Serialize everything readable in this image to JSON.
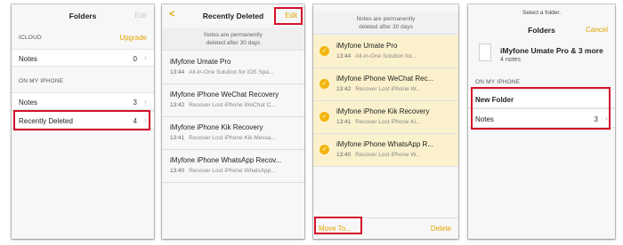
{
  "panel1": {
    "title": "Folders",
    "edit": "Edit",
    "icloud_label": "ICLOUD",
    "upgrade": "Upgrade",
    "icloud_notes": {
      "label": "Notes",
      "count": "0"
    },
    "iphone_label": "ON MY IPHONE",
    "iphone_notes": {
      "label": "Notes",
      "count": "3"
    },
    "recently_deleted": {
      "label": "Recently Deleted",
      "count": "4"
    }
  },
  "panel2": {
    "back": "<",
    "title": "Recently Deleted",
    "edit": "Edit",
    "banner_line1": "Notes are permanently",
    "banner_line2": "deleted after 30 days",
    "notes": [
      {
        "title": "iMyfone Umate Pro",
        "time": "13:44",
        "snippet": "All-in-One Solution for iOS Spa..."
      },
      {
        "title": "iMyfone iPhone WeChat Recovery",
        "time": "13:42",
        "snippet": "Recover Lost iPhone WeChat C..."
      },
      {
        "title": "iMyfone iPhone Kik Recovery",
        "time": "13:41",
        "snippet": "Recover Lost iPhone Kik Messa..."
      },
      {
        "title": "iMyfone iPhone WhatsApp Recov...",
        "time": "13:40",
        "snippet": "Recover Lost iPhone WhatsApp..."
      }
    ]
  },
  "panel3": {
    "banner_line1": "Notes are permanently",
    "banner_line2": "deleted after 30 days",
    "notes": [
      {
        "title": "iMyfone Umate Pro",
        "time": "13:44",
        "snippet": "All-in-One Solution for..."
      },
      {
        "title": "iMyfone iPhone WeChat Rec...",
        "time": "13:42",
        "snippet": "Recover Lost iPhone W..."
      },
      {
        "title": "iMyfone iPhone Kik Recovery",
        "time": "13:41",
        "snippet": "Recover Lost iPhone Ki..."
      },
      {
        "title": "iMyfone iPhone WhatsApp R...",
        "time": "13:40",
        "snippet": "Recover Lost iPhone W..."
      }
    ],
    "move_to": "Move To...",
    "delete": "Delete"
  },
  "panel4": {
    "prompt": "Select a folder.",
    "title": "Folders",
    "cancel": "Cancel",
    "selection_title": "iMyfone Umate Pro & 3 more",
    "selection_sub": "4 notes",
    "section_label": "ON MY IPHONE",
    "new_folder": "New Folder",
    "notes": {
      "label": "Notes",
      "count": "3"
    }
  },
  "colors": {
    "accent": "#e3a400",
    "highlight": "#d4112a",
    "selected_bg": "#fbf1cc",
    "check": "#f2b50e"
  },
  "icons": {
    "chevron": "chevron-right-icon",
    "check": "checkmark-icon",
    "back": "chevron-left-icon"
  }
}
